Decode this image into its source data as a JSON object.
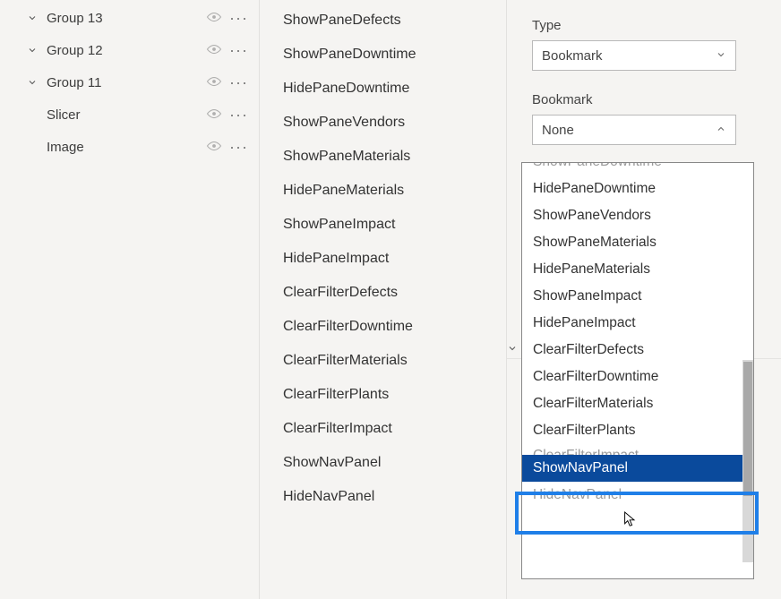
{
  "tree": {
    "items": [
      {
        "label": "Group 13",
        "hasArrow": true
      },
      {
        "label": "Group 12",
        "hasArrow": true
      },
      {
        "label": "Group 11",
        "hasArrow": true
      },
      {
        "label": "Slicer",
        "hasArrow": false
      },
      {
        "label": "Image",
        "hasArrow": false
      }
    ]
  },
  "bookmarks_list": [
    "ShowPaneDefects",
    "ShowPaneDowntime",
    "HidePaneDowntime",
    "ShowPaneVendors",
    "ShowPaneMaterials",
    "HidePaneMaterials",
    "ShowPaneImpact",
    "HidePaneImpact",
    "ClearFilterDefects",
    "ClearFilterDowntime",
    "ClearFilterMaterials",
    "ClearFilterPlants",
    "ClearFilterImpact",
    "ShowNavPanel",
    "HideNavPanel"
  ],
  "action": {
    "type_label": "Type",
    "type_value": "Bookmark",
    "bookmark_label": "Bookmark",
    "bookmark_value": "None",
    "dropdown_items": [
      {
        "label": "ShowPaneDowntime",
        "clipped": true
      },
      {
        "label": "HidePaneDowntime"
      },
      {
        "label": "ShowPaneVendors"
      },
      {
        "label": "ShowPaneMaterials"
      },
      {
        "label": "HidePaneMaterials"
      },
      {
        "label": "ShowPaneImpact"
      },
      {
        "label": "HidePaneImpact"
      },
      {
        "label": "ClearFilterDefects"
      },
      {
        "label": "ClearFilterDowntime"
      },
      {
        "label": "ClearFilterMaterials"
      },
      {
        "label": "ClearFilterPlants"
      },
      {
        "label": "ClearFilterImpact",
        "hidden_under": true
      },
      {
        "label": "ShowNavPanel",
        "selected": true
      },
      {
        "label": "HideNavPanel",
        "hidden_under": true
      }
    ]
  }
}
